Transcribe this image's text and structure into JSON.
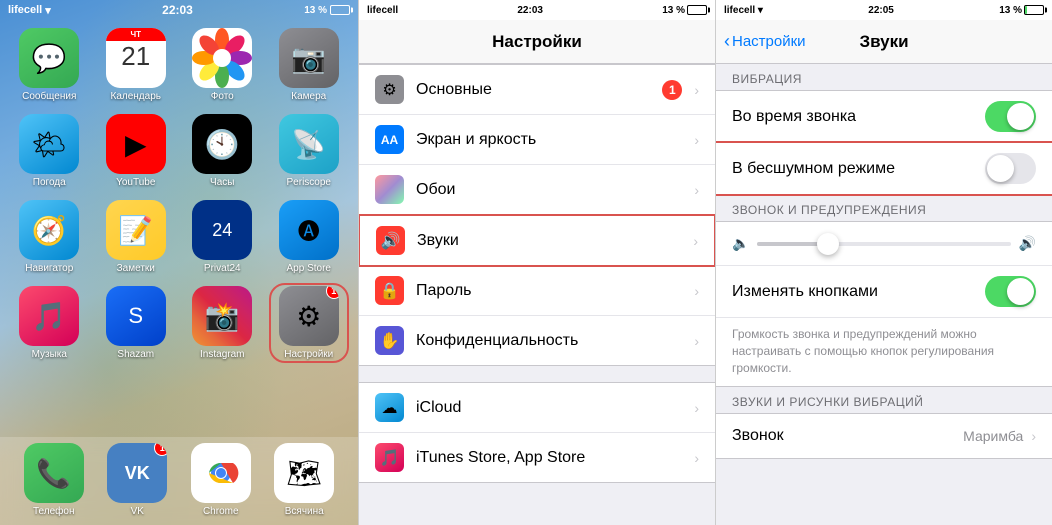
{
  "panel1": {
    "statusBar": {
      "carrier": "lifecell",
      "time": "22:03",
      "battery": "13 %"
    },
    "apps": [
      {
        "label": "Сообщения",
        "icon": "messages",
        "badge": null
      },
      {
        "label": "Календарь",
        "icon": "calendar",
        "badge": null,
        "calDay": "21"
      },
      {
        "label": "Фото",
        "icon": "photos",
        "badge": null
      },
      {
        "label": "Камера",
        "icon": "camera",
        "badge": null
      },
      {
        "label": "Погода",
        "icon": "weather",
        "badge": null
      },
      {
        "label": "YouTube",
        "icon": "youtube",
        "badge": null
      },
      {
        "label": "Часы",
        "icon": "clock",
        "badge": null
      },
      {
        "label": "Periscope",
        "icon": "periscope",
        "badge": null
      },
      {
        "label": "Навигатор",
        "icon": "navigator",
        "badge": null
      },
      {
        "label": "Заметки",
        "icon": "notes",
        "badge": null
      },
      {
        "label": "Privat24",
        "icon": "privat",
        "badge": null,
        "calDay": "24"
      },
      {
        "label": "App Store",
        "icon": "appstore",
        "badge": null
      },
      {
        "label": "Музыка",
        "icon": "music",
        "badge": null
      },
      {
        "label": "Shazam",
        "icon": "shazam",
        "badge": null
      },
      {
        "label": "Instagram",
        "icon": "instagram",
        "badge": null
      },
      {
        "label": "Настройки",
        "icon": "settings",
        "badge": "1",
        "highlighted": true
      }
    ],
    "dock": [
      {
        "label": "Телефон",
        "icon": "phone",
        "badge": null
      },
      {
        "label": "VK",
        "icon": "vk",
        "badge": "1"
      },
      {
        "label": "Chrome",
        "icon": "chrome",
        "badge": null
      },
      {
        "label": "Всячина",
        "icon": "maps",
        "badge": null
      }
    ]
  },
  "panel2": {
    "statusBar": {
      "carrier": "lifecell",
      "time": "22:03",
      "battery": "13 %"
    },
    "navTitle": "Настройки",
    "rows": [
      {
        "label": "Основные",
        "iconType": "gray",
        "iconSymbol": "⚙",
        "badge": "1"
      },
      {
        "label": "Экран и яркость",
        "iconType": "blue",
        "iconSymbol": "AA"
      },
      {
        "label": "Обои",
        "iconType": "gray2",
        "iconSymbol": "🌅"
      },
      {
        "label": "Звуки",
        "iconType": "red-speaker",
        "iconSymbol": "🔊",
        "highlighted": true
      },
      {
        "label": "Пароль",
        "iconType": "red",
        "iconSymbol": "🔒"
      },
      {
        "label": "Конфиденциальность",
        "iconType": "purple",
        "iconSymbol": "✋"
      },
      {
        "label": "iCloud",
        "iconType": "icloud",
        "iconSymbol": "☁"
      },
      {
        "label": "iTunes Store, App Store",
        "iconType": "itunes",
        "iconSymbol": "🎵"
      }
    ]
  },
  "panel3": {
    "statusBar": {
      "carrier": "lifecell",
      "time": "22:05",
      "battery": "13 %"
    },
    "backLabel": "Настройки",
    "navTitle": "Звуки",
    "sections": {
      "vibration": {
        "header": "ВИБРАЦИЯ",
        "rows": [
          {
            "label": "Во время звонка",
            "toggle": "on"
          },
          {
            "label": "В бесшумном режиме",
            "toggle": "off",
            "highlighted": true
          }
        ]
      },
      "ringtone": {
        "header": "ЗВОНОК И ПРЕДУПРЕЖДЕНИЯ",
        "sliderMin": "🔈",
        "sliderMax": "🔊"
      },
      "changeWithButtons": {
        "label": "Изменять кнопками",
        "toggle": "on",
        "info": "Громкость звонка и предупреждений можно настраивать с помощью кнопок регулирования громкости."
      },
      "sounds": {
        "header": "ЗВУКИ И РИСУНКИ ВИБРАЦИЙ"
      },
      "zvonok": {
        "label": "Звонок",
        "value": "Маримба"
      }
    }
  }
}
